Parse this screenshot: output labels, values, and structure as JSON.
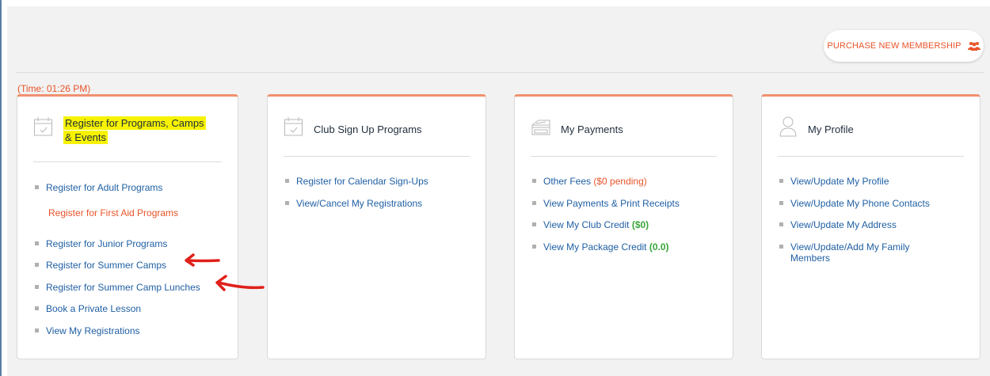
{
  "header": {
    "purchase_label": "PURCHASE NEW MEMBERSHIP",
    "purchase_icon": "group-users-icon",
    "time_label": "(Time: 01:26 PM)"
  },
  "colors": {
    "accent": "#e8542a",
    "link": "#1f5fa3",
    "highlight": "#f7f300",
    "credit_green": "#3aa53a",
    "annotation_red": "#e0201a"
  },
  "cards": [
    {
      "title_line1": "Register for Programs, Camps",
      "title_line2": "& Events",
      "icon": "calendar-check-icon",
      "items": [
        "Register for Adult Programs",
        "Register for First Aid Programs",
        "Register for Junior Programs",
        "Register for Summer Camps",
        "Register for Summer Camp Lunches",
        "Book a Private Lesson",
        "View My Registrations"
      ]
    },
    {
      "title": "Club Sign Up Programs",
      "icon": "calendar-check-icon",
      "items": [
        "Register for Calendar Sign-Ups",
        "View/Cancel My Registrations"
      ]
    },
    {
      "title": "My Payments",
      "icon": "credit-card-icon",
      "items": [
        {
          "text": "Other Fees",
          "extra": "($0 pending)"
        },
        {
          "text": "View Payments & Print Receipts"
        },
        {
          "text": "View My Club Credit",
          "extra": "($0)"
        },
        {
          "text": "View My Package Credit",
          "extra": "(0.0)"
        }
      ]
    },
    {
      "title": "My Profile",
      "icon": "user-profile-icon",
      "items": [
        "View/Update My Profile",
        "View/Update My Phone Contacts",
        "View/Update My Address",
        "View/Update/Add My Family Members"
      ]
    }
  ]
}
